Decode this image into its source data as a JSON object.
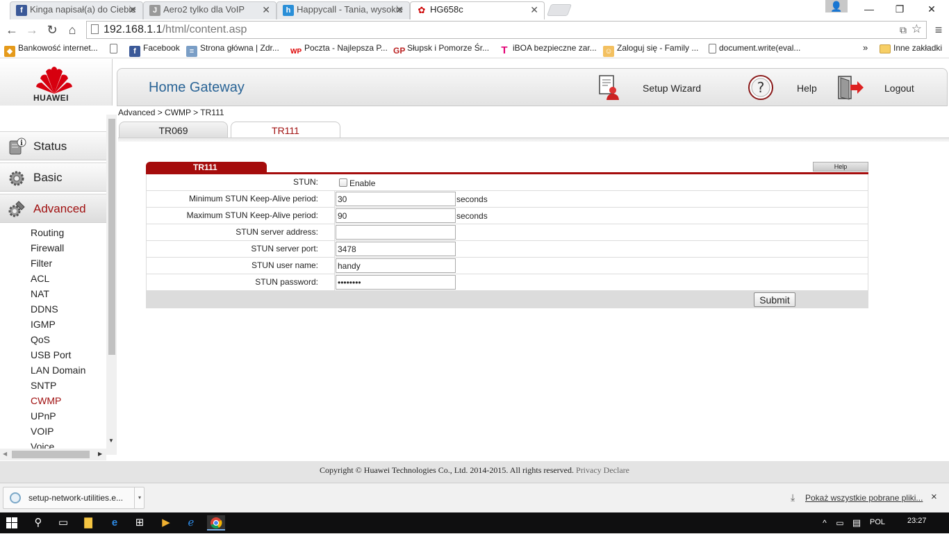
{
  "browser": {
    "tabs": [
      {
        "title": "Kinga napisał(a) do Ciebie",
        "icon": "facebook-icon",
        "color": "#3b5998"
      },
      {
        "title": "Aero2 tylko dla VoIP",
        "icon": "jd-icon",
        "color": "#888888"
      },
      {
        "title": "Happycall - Tania, wysokie",
        "icon": "happycall-icon",
        "color": "#2a8fd8"
      },
      {
        "title": "HG658c",
        "icon": "huawei-icon",
        "color": "#cc0000"
      }
    ],
    "address": {
      "host": "192.168.1.1",
      "path": "/html/content.asp"
    },
    "bookmarks": [
      {
        "label": "Bankowość internet...",
        "icon": "bank-icon"
      },
      {
        "label": "",
        "icon": "page-icon"
      },
      {
        "label": "Facebook",
        "icon": "facebook-icon"
      },
      {
        "label": "Strona główna | Zdr...",
        "icon": "site-icon"
      },
      {
        "label": "Poczta - Najlepsza P...",
        "icon": "wp-icon"
      },
      {
        "label": "Słupsk i Pomorze Śr...",
        "icon": "gp-icon"
      },
      {
        "label": "iBOA bezpieczne zar...",
        "icon": "tmobile-icon"
      },
      {
        "label": "Zaloguj się - Family ...",
        "icon": "family-icon"
      },
      {
        "label": "document.write(eval...",
        "icon": "page-icon"
      }
    ],
    "bookmarks_more": "»",
    "other_bookmarks": "Inne zakładki"
  },
  "header": {
    "logo_text": "HUAWEI",
    "title": "Home Gateway",
    "setup_wizard": "Setup Wizard",
    "help": "Help",
    "logout": "Logout"
  },
  "breadcrumb": "Advanced > CWMP > TR111",
  "subtabs": [
    "TR069",
    "TR111"
  ],
  "sidebar": {
    "main": [
      {
        "label": "Status"
      },
      {
        "label": "Basic"
      },
      {
        "label": "Advanced"
      }
    ],
    "submenu": [
      "Routing",
      "Firewall",
      "Filter",
      "ACL",
      "NAT",
      "DDNS",
      "IGMP",
      "QoS",
      "USB Port",
      "LAN Domain",
      "SNTP",
      "CWMP",
      "UPnP",
      "VOIP",
      "Voice"
    ]
  },
  "form": {
    "panel_title": "TR111",
    "help_label": "Help",
    "stun_label": "STUN:",
    "stun_enable_label": "Enable",
    "min_label": "Minimum STUN Keep-Alive period:",
    "min_value": "30",
    "max_label": "Maximum STUN Keep-Alive period:",
    "max_value": "90",
    "unit_seconds": "seconds",
    "server_address_label": "STUN server address:",
    "server_address_value": "",
    "server_port_label": "STUN server port:",
    "server_port_value": "3478",
    "user_label": "STUN user name:",
    "user_value": "handy",
    "password_label": "STUN password:",
    "password_value": "********",
    "submit_label": "Submit"
  },
  "footer": {
    "copyright": "Copyright © Huawei Technologies Co., Ltd. 2014-2015. All rights reserved.",
    "privacy": "Privacy Declare"
  },
  "download": {
    "file": "setup-network-utilities.e...",
    "show_all": "Pokaż wszystkie pobrane pliki...",
    "close": "×"
  },
  "taskbar": {
    "lang": "POL",
    "time": "23:27"
  }
}
